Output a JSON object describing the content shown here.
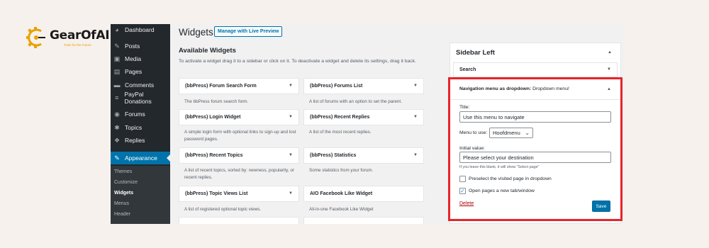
{
  "logo": {
    "name": "GearOfAI",
    "tagline": "Tools for the Future"
  },
  "admin_menu": [
    {
      "label": "Dashboard",
      "icon": "dashboard-icon",
      "glyph": "◕"
    },
    {
      "label": "Posts",
      "icon": "pin-icon",
      "glyph": "✎"
    },
    {
      "label": "Media",
      "icon": "media-icon",
      "glyph": "▣"
    },
    {
      "label": "Pages",
      "icon": "pages-icon",
      "glyph": "▤"
    },
    {
      "label": "Comments",
      "icon": "comments-icon",
      "glyph": "▬"
    },
    {
      "label": "PayPal Donations",
      "icon": "paypal-icon",
      "glyph": "≡"
    },
    {
      "label": "Forums",
      "icon": "forums-icon",
      "glyph": "◉"
    },
    {
      "label": "Topics",
      "icon": "topics-icon",
      "glyph": "✱"
    },
    {
      "label": "Replies",
      "icon": "replies-icon",
      "glyph": "❖"
    },
    {
      "label": "Appearance",
      "icon": "appearance-icon",
      "glyph": "✎"
    }
  ],
  "appearance_submenu": [
    "Themes",
    "Customize",
    "Widgets",
    "Menus",
    "Header"
  ],
  "header": {
    "title": "Widgets",
    "live_preview": "Manage with Live Preview"
  },
  "available": {
    "title": "Available Widgets",
    "description": "To activate a widget drag it to a sidebar or click on it. To deactivate a widget and delete its settings, drag it back."
  },
  "widgets": [
    {
      "name": "(bbPress) Forum Search Form",
      "desc": "The bbPress forum search form."
    },
    {
      "name": "(bbPress) Forums List",
      "desc": "A list of forums with an option to set the parent."
    },
    {
      "name": "(bbPress) Login Widget",
      "desc": "A simple login form with optional links to sign-up and lost password pages."
    },
    {
      "name": "(bbPress) Recent Replies",
      "desc": "A list of the most recent replies."
    },
    {
      "name": "(bbPress) Recent Topics",
      "desc": "A list of recent topics, sorted by: newness, popularity, or recent replies."
    },
    {
      "name": "(bbPress) Statistics",
      "desc": "Some statistics from your forum."
    },
    {
      "name": "(bbPress) Topic Views List",
      "desc": "A list of registered optional topic views."
    },
    {
      "name": "AIO Facebook Like Widget",
      "desc": "All-in-one Facebook Like Widget"
    }
  ],
  "sidebar_left": {
    "title": "Sidebar Left",
    "search_widget": "Search",
    "nav_widget": {
      "name": "Navigation menu as dropdown:",
      "subtitle": "Dropdown menu!",
      "title_label": "Title:",
      "title_value": "Use this menu to navigate",
      "menu_label": "Menu to use:",
      "menu_value": "Hoofdmenu",
      "initial_label": "Initial value:",
      "initial_value": "Please select your destination",
      "initial_hint": "If you leave this blank, it will show \"Select page\"",
      "preselect_label": "Preselect the visited page in dropdown",
      "preselect_checked": false,
      "newtab_label": "Open pages a new tab/window",
      "newtab_checked": true,
      "delete": "Delete",
      "save": "Save"
    }
  },
  "colors": {
    "accent": "#0073aa",
    "highlight": "#e8232a",
    "admin_bg": "#23282d"
  }
}
